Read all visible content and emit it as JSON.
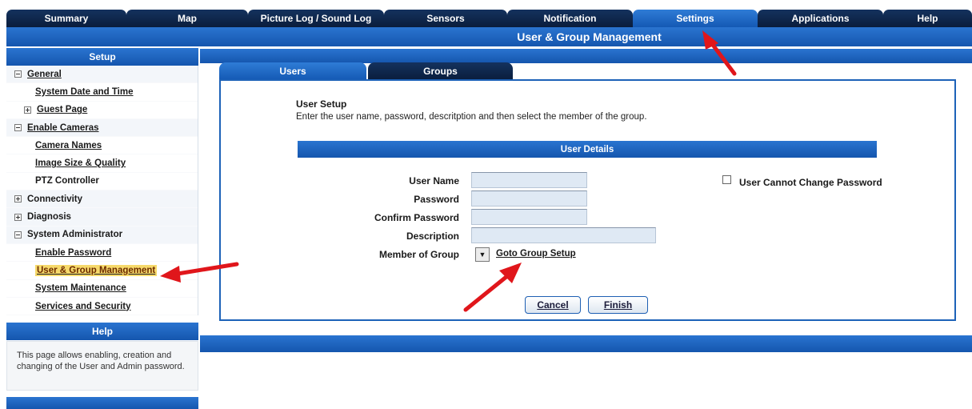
{
  "top_tabs": [
    {
      "label": "Summary"
    },
    {
      "label": "Map"
    },
    {
      "label": "Picture Log / Sound Log"
    },
    {
      "label": "Sensors"
    },
    {
      "label": "Notification"
    },
    {
      "label": "Settings",
      "active": true
    },
    {
      "label": "Applications"
    },
    {
      "label": "Help"
    }
  ],
  "page_title": "User & Group Management",
  "sidebar": {
    "header": "Setup",
    "items": [
      {
        "label": "General",
        "type": "section",
        "expanded": true
      },
      {
        "label": "System Date and Time",
        "type": "link"
      },
      {
        "label": "Guest Page",
        "type": "subsection",
        "expanded": false
      },
      {
        "label": "Enable Cameras",
        "type": "section",
        "expanded": true
      },
      {
        "label": "Camera Names",
        "type": "link"
      },
      {
        "label": "Image Size & Quality",
        "type": "link"
      },
      {
        "label": "PTZ Controller",
        "type": "link"
      },
      {
        "label": "Connectivity",
        "type": "section",
        "expanded": false
      },
      {
        "label": "Diagnosis",
        "type": "section",
        "expanded": false
      },
      {
        "label": "System Administrator",
        "type": "section",
        "expanded": true
      },
      {
        "label": "Enable Password",
        "type": "link"
      },
      {
        "label": "User & Group Management",
        "type": "link",
        "selected": true
      },
      {
        "label": "System Maintenance",
        "type": "link"
      },
      {
        "label": "Services and Security",
        "type": "link"
      }
    ]
  },
  "help": {
    "header": "Help",
    "text": "This page allows enabling, creation and changing of the User and Admin password."
  },
  "sub_tabs": [
    {
      "label": "Users",
      "active": true
    },
    {
      "label": "Groups"
    }
  ],
  "user_setup": {
    "title": "User Setup",
    "description": "Enter the user name, password, descritption and then select the member of the group.",
    "details_header": "User Details"
  },
  "form": {
    "user_name": {
      "label": "User Name",
      "value": ""
    },
    "password": {
      "label": "Password",
      "value": ""
    },
    "confirm_password": {
      "label": "Confirm Password",
      "value": ""
    },
    "description": {
      "label": "Description",
      "value": ""
    },
    "member_of_group": {
      "label": "Member of Group",
      "value": ""
    },
    "goto_group_setup": "Goto Group Setup",
    "cannot_change_password": {
      "label": "User Cannot Change Password",
      "checked": false
    }
  },
  "buttons": {
    "cancel": "Cancel",
    "finish": "Finish"
  },
  "colors": {
    "accent_blue": "#1556ae",
    "dark_tab": "#0a1d3c",
    "arrow_red": "#e0161b",
    "highlight": "#f6d96b"
  }
}
